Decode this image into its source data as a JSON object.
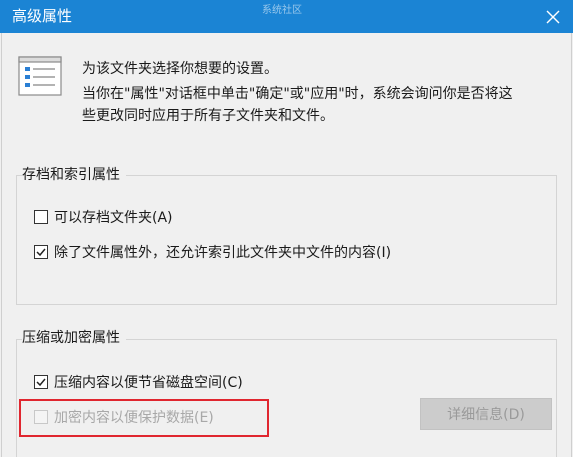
{
  "window": {
    "title": "高级属性",
    "watermark": "系统社区",
    "close_icon": "close-icon"
  },
  "intro": {
    "line1": "为该文件夹选择你想要的设置。",
    "line2": "当你在\"属性\"对话框中单击\"确定\"或\"应用\"时，系统会询问你是否将这",
    "line3": "些更改同时应用于所有子文件夹和文件。",
    "icon": "document-list-icon"
  },
  "archive_group": {
    "label": "存档和索引属性",
    "options": [
      {
        "label": "可以存档文件夹(A)",
        "checked": false,
        "enabled": true
      },
      {
        "label": "除了文件属性外，还允许索引此文件夹中文件的内容(I)",
        "checked": true,
        "enabled": true
      }
    ]
  },
  "compress_group": {
    "label": "压缩或加密属性",
    "options": [
      {
        "label": "压缩内容以便节省磁盘空间(C)",
        "checked": true,
        "enabled": true
      },
      {
        "label": "加密内容以便保护数据(E)",
        "checked": false,
        "enabled": false
      }
    ],
    "details_button": "详细信息(D)",
    "details_enabled": false
  },
  "colors": {
    "titlebar": "#1b84d4",
    "highlight": "#e0262f"
  }
}
